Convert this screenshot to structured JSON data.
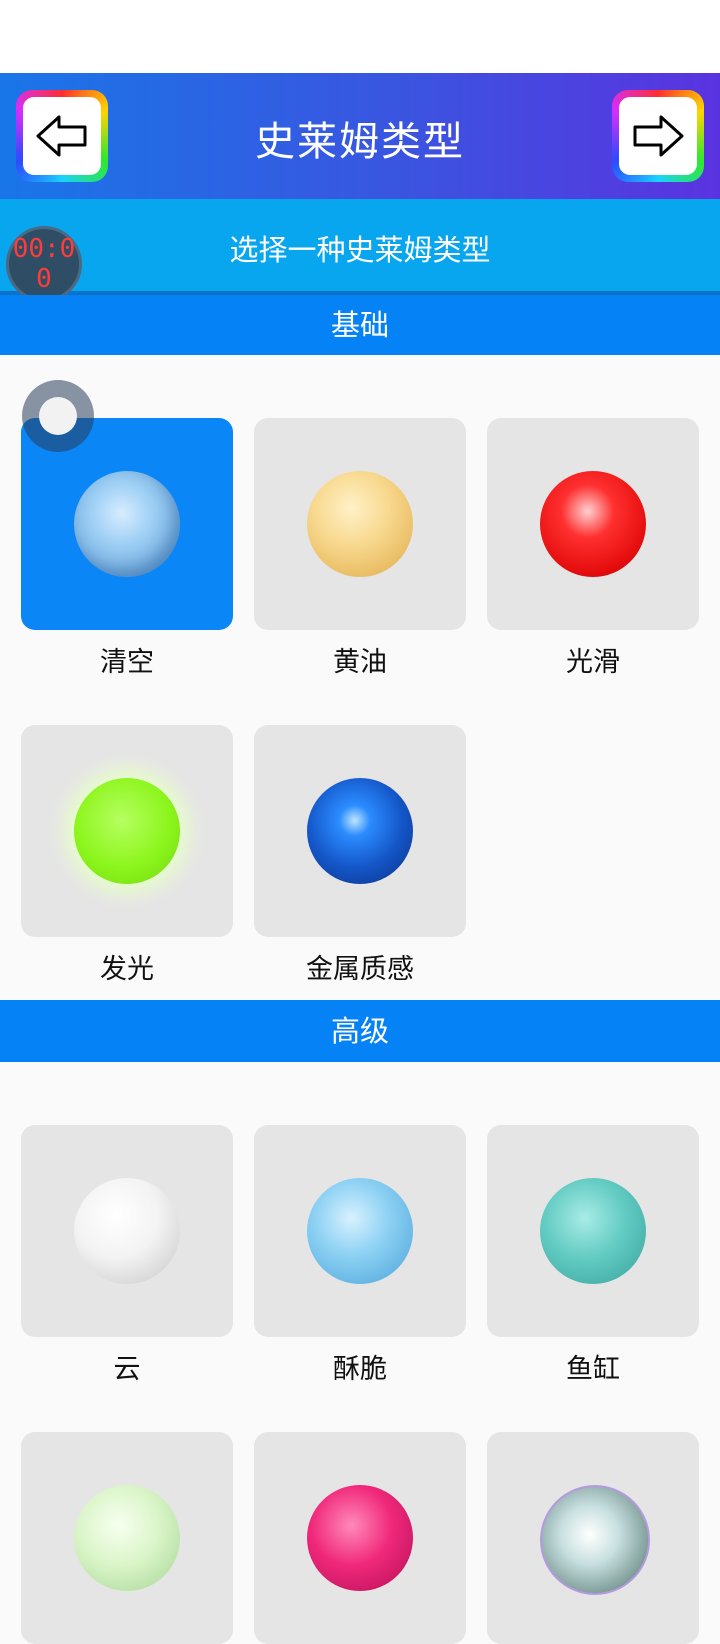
{
  "header": {
    "title": "史莱姆类型",
    "back_icon": "arrow-left-icon",
    "forward_icon": "arrow-right-icon"
  },
  "subheader": {
    "text": "选择一种史莱姆类型"
  },
  "timer": {
    "text": "00:00"
  },
  "sections": [
    {
      "title": "基础",
      "items": [
        {
          "label": "清空",
          "selected": true,
          "color": "#8cc4f0"
        },
        {
          "label": "黄油",
          "selected": false,
          "color": "#f7d486"
        },
        {
          "label": "光滑",
          "selected": false,
          "color": "#ff1e1e"
        },
        {
          "label": "发光",
          "selected": false,
          "color": "#8cf51c"
        },
        {
          "label": "金属质感",
          "selected": false,
          "color": "#1a5fd0"
        }
      ]
    },
    {
      "title": "高级",
      "items": [
        {
          "label": "云",
          "selected": false,
          "color": "#f0f0f0"
        },
        {
          "label": "酥脆",
          "selected": false,
          "color": "#7cc6ef"
        },
        {
          "label": "鱼缸",
          "selected": false,
          "color": "#58c8c0"
        },
        {
          "label": "",
          "selected": false,
          "color": "#d8f5c8"
        },
        {
          "label": "",
          "selected": false,
          "color": "#f0287a"
        },
        {
          "label": "",
          "selected": false,
          "color": "#c8d8d8"
        }
      ]
    }
  ]
}
